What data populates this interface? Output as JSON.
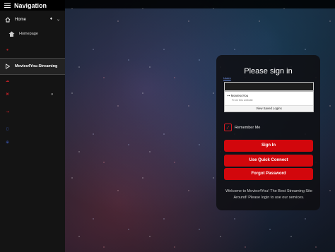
{
  "nav": {
    "title": "Navigation",
    "home_label": "Home",
    "homepage_label": "Homepage",
    "active_item_label": "Movies4You-Streaming",
    "hidden_rows": 6
  },
  "signin": {
    "title": "Please sign in",
    "username_label": "Usern",
    "autofill": {
      "account": "Movies4You",
      "source": "From this website",
      "saved_logins": "View Saved Logins"
    },
    "remember_label": "Remember Me",
    "buttons": {
      "signin": "Sign In",
      "quick_connect": "Use Quick Connect",
      "forgot": "Forgot Password"
    },
    "welcome": "Welcome to Movies4You! The Best Streaming Site Around! Please login to use our services."
  },
  "colors": {
    "accent": "#d2070c",
    "sidebar": "#141414",
    "link": "#3d5bbf"
  }
}
